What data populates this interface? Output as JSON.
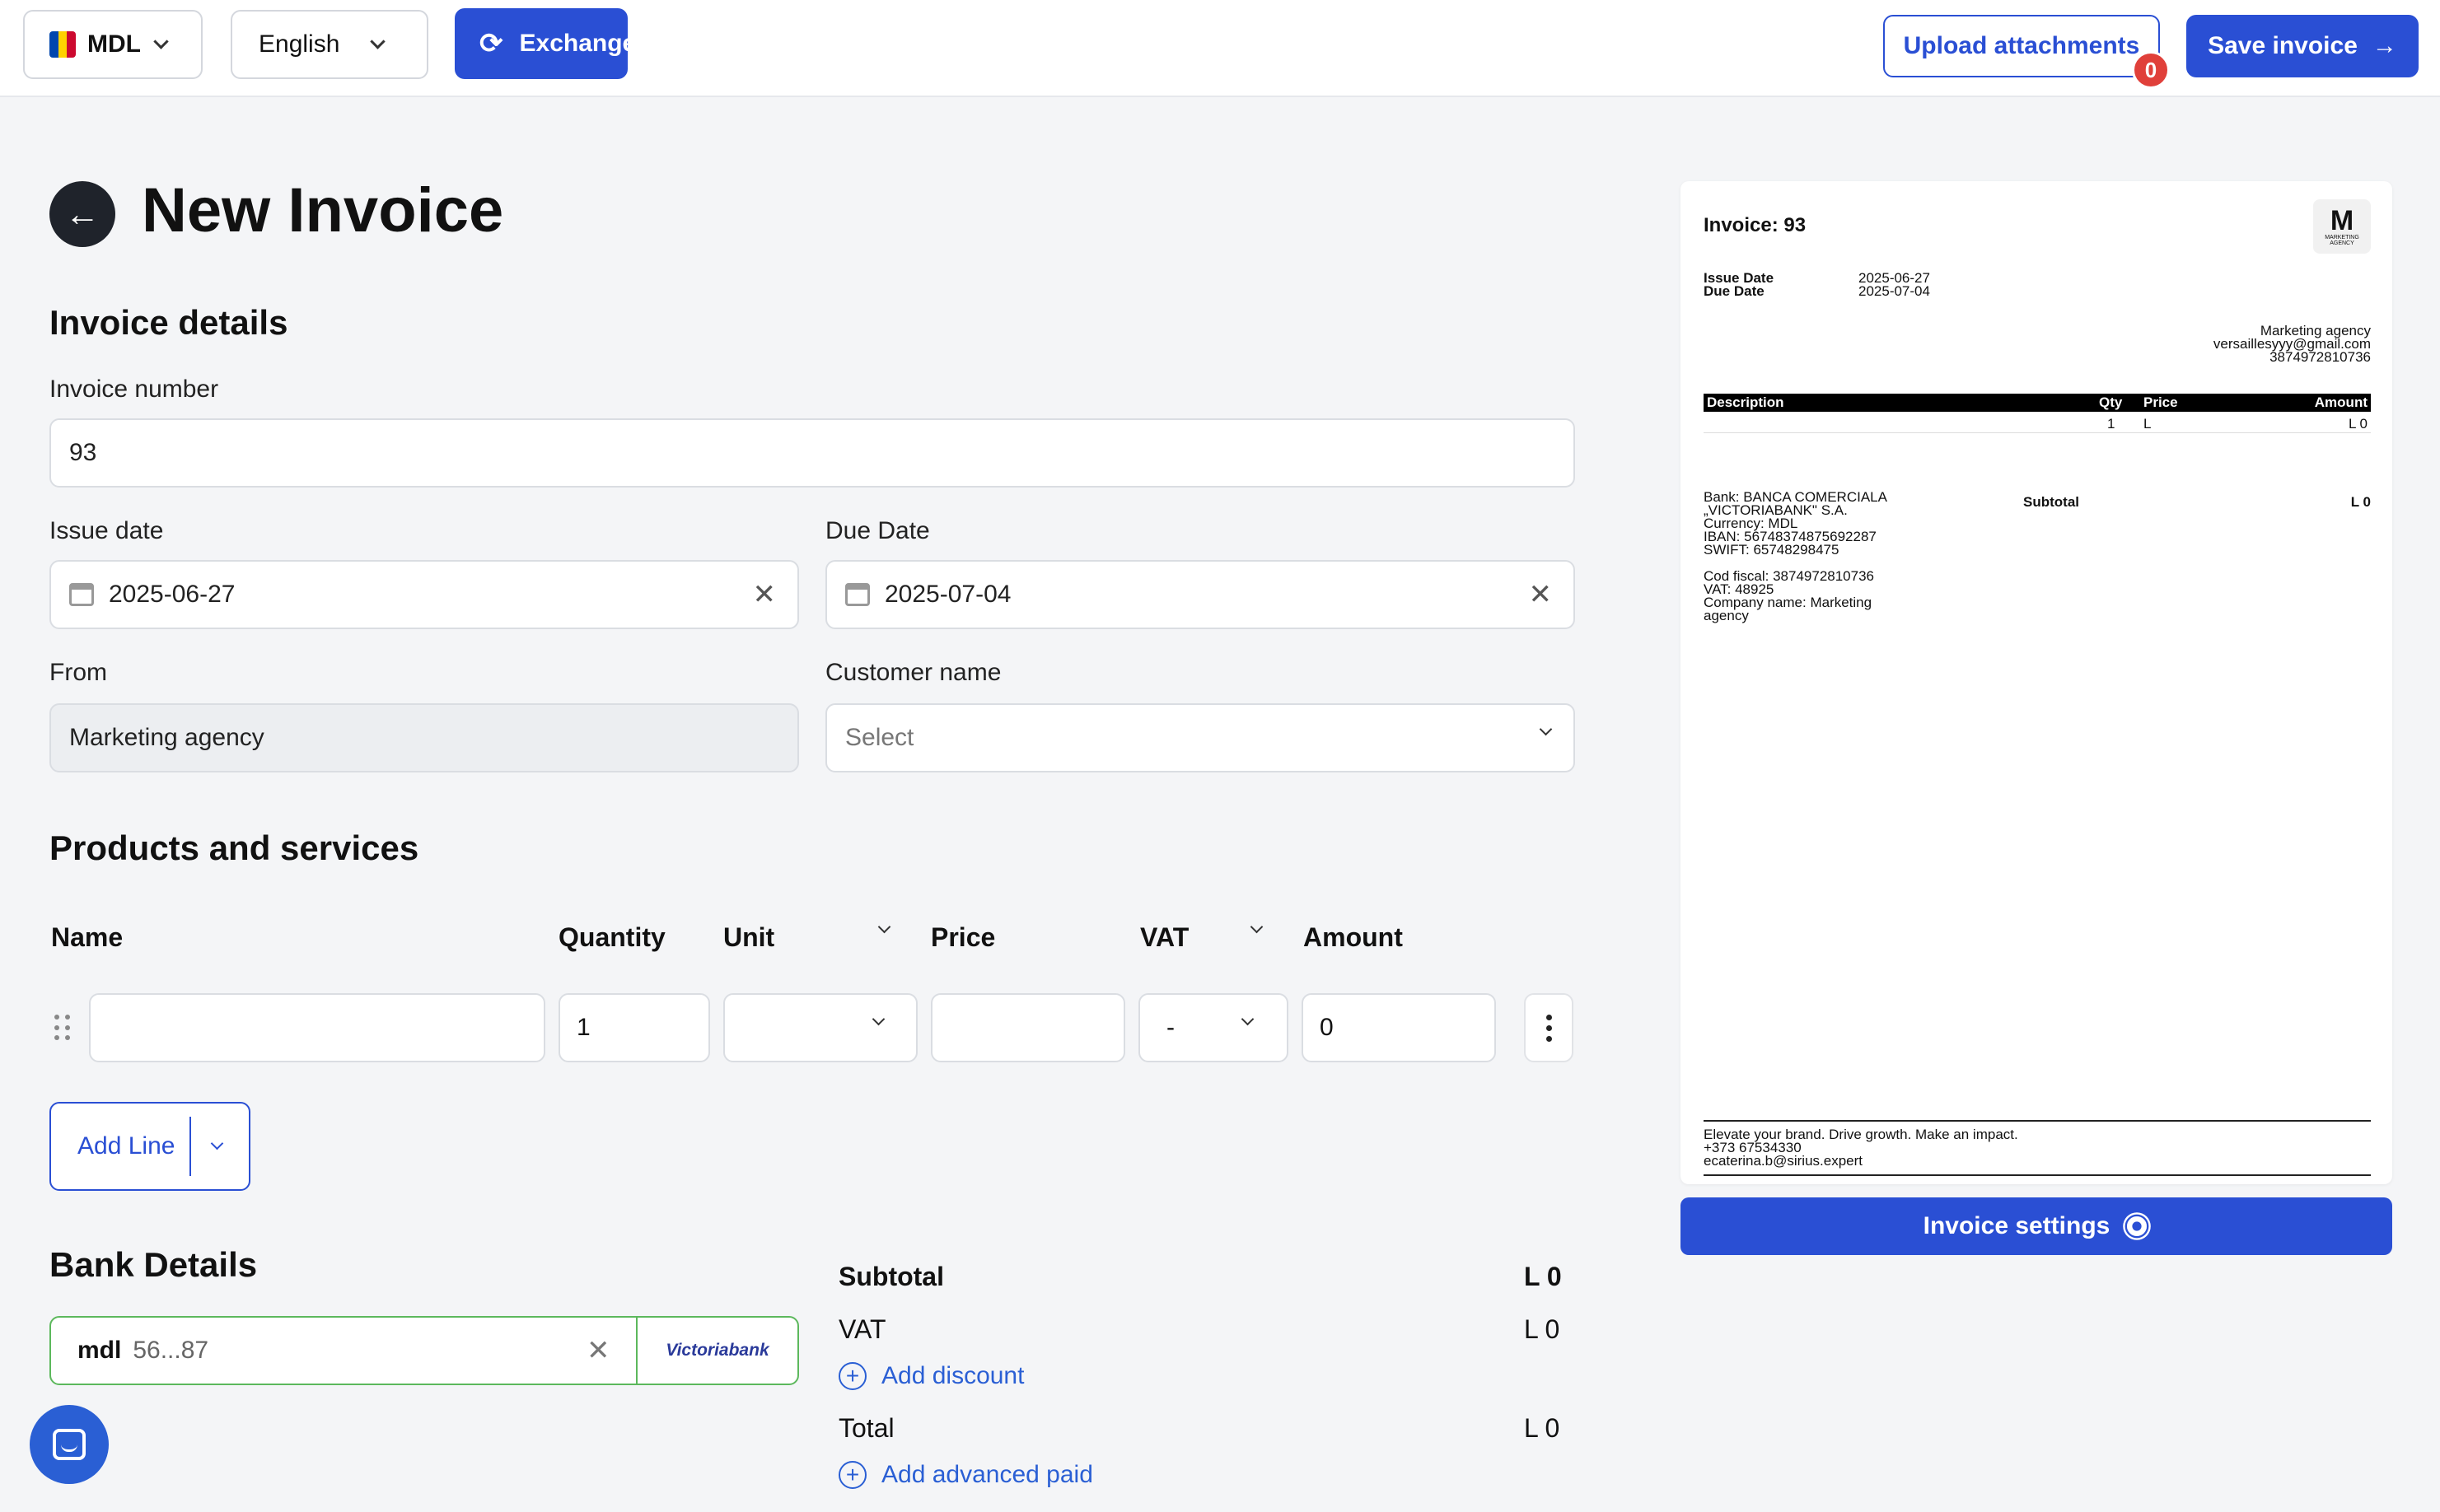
{
  "topbar": {
    "currency": "MDL",
    "language": "English",
    "exchange_label": "Exchange",
    "upload_label": "Upload attachments",
    "attachments_count": "0",
    "save_label": "Save invoice",
    "save_arrow": "→"
  },
  "header": {
    "back_icon": "←",
    "title": "New Invoice"
  },
  "details": {
    "section_title": "Invoice details",
    "invoice_number_label": "Invoice number",
    "invoice_number": "93",
    "issue_date_label": "Issue date",
    "issue_date": "2025-06-27",
    "due_date_label": "Due Date",
    "due_date": "2025-07-04",
    "from_label": "From",
    "from_value": "Marketing agency",
    "customer_label": "Customer name",
    "customer_placeholder": "Select",
    "clear_icon": "✕"
  },
  "products": {
    "section_title": "Products and services",
    "columns": {
      "name": "Name",
      "quantity": "Quantity",
      "unit": "Unit",
      "price": "Price",
      "vat": "VAT",
      "amount": "Amount"
    },
    "row": {
      "name": "",
      "quantity": "1",
      "unit": "",
      "price": "",
      "vat": "-",
      "amount": "0"
    },
    "add_line_label": "Add Line"
  },
  "bank": {
    "section_title": "Bank Details",
    "currency": "mdl",
    "account_masked": "56...87",
    "bank_logo_text": "Victoriabank",
    "clear_icon": "✕"
  },
  "totals": {
    "subtotal_label": "Subtotal",
    "subtotal_value": "L 0",
    "vat_label": "VAT",
    "vat_value": "L 0",
    "add_discount": "Add discount",
    "total_label": "Total",
    "total_value": "L 0",
    "add_advanced_paid": "Add advanced paid",
    "plus_icon": "+"
  },
  "preview": {
    "title": "Invoice: 93",
    "logo_letter": "M",
    "logo_text": "MARKETING AGENCY",
    "issue_date_label": "Issue Date",
    "issue_date": "2025-06-27",
    "due_date_label": "Due Date",
    "due_date": "2025-07-04",
    "company_name": "Marketing agency",
    "company_email": "versaillesyyy@gmail.com",
    "company_phone": "3874972810736",
    "table_headers": {
      "description": "Description",
      "qty": "Qty",
      "price": "Price",
      "amount": "Amount"
    },
    "table_row": {
      "qty": "1",
      "price": "L",
      "amount": "L 0"
    },
    "bank_lines": [
      "Bank: BANCA COMERCIALA",
      "„VICTORIABANK\" S.A.",
      "Currency: MDL",
      "IBAN: 56748374875692287",
      "SWIFT: 65748298475"
    ],
    "company_lines": [
      "Cod fiscal: 3874972810736",
      "VAT: 48925",
      "Company name: Marketing",
      "agency"
    ],
    "subtotal_label": "Subtotal",
    "subtotal_value": "L 0",
    "footer_lines": [
      "Elevate your brand. Drive growth. Make an impact.",
      "+373 67534330",
      "ecaterina.b@sirius.expert"
    ]
  },
  "settings_label": "Invoice settings",
  "colors": {
    "primary": "#2a4fd4",
    "link": "#2a5fd4",
    "badge": "#e0403a",
    "bank_border": "#5cb85c"
  }
}
